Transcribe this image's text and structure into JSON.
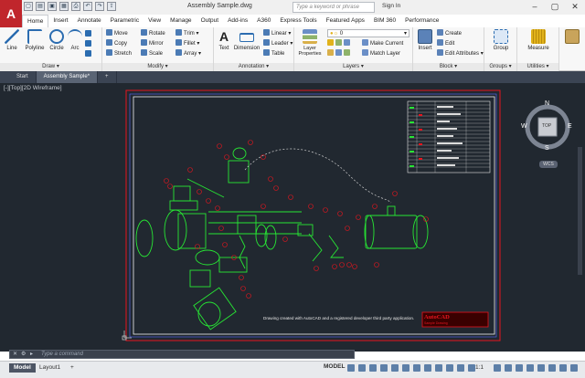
{
  "app": {
    "logo_letter": "A",
    "document_title": "Assembly Sample.dwg",
    "search_placeholder": "Type a keyword or phrase",
    "signin_label": "Sign In"
  },
  "qat_icons": [
    "new-icon",
    "open-icon",
    "save-icon",
    "saveas-icon",
    "print-icon",
    "undo-icon",
    "redo-icon",
    "share-icon"
  ],
  "tabs": [
    "Home",
    "Insert",
    "Annotate",
    "Parametric",
    "View",
    "Manage",
    "Output",
    "Add-ins",
    "A360",
    "Express Tools",
    "Featured Apps",
    "BIM 360",
    "Performance"
  ],
  "ribbon": {
    "draw": {
      "title": "Draw",
      "line": "Line",
      "polyline": "Polyline",
      "circle": "Circle",
      "arc": "Arc"
    },
    "modify": {
      "title": "Modify",
      "move": "Move",
      "copy": "Copy",
      "stretch": "Stretch",
      "rotate": "Rotate",
      "mirror": "Mirror",
      "scale": "Scale",
      "trim": "Trim",
      "fillet": "Fillet",
      "array": "Array"
    },
    "annotation": {
      "title": "Annotation",
      "text": "Text",
      "dimension": "Dimension",
      "linear": "Linear",
      "leader": "Leader",
      "table": "Table"
    },
    "layers": {
      "title": "Layers",
      "layer_properties": "Layer Properties",
      "layer_value": "0",
      "make_current": "Make Current",
      "match_layer": "Match Layer"
    },
    "block": {
      "title": "Block",
      "insert": "Insert",
      "create": "Create",
      "edit": "Edit",
      "edit_attributes": "Edit Attributes"
    },
    "groups": {
      "title": "Groups",
      "group": "Group"
    },
    "utilities": {
      "title": "Utilities",
      "measure": "Measure"
    }
  },
  "file_tabs": [
    "Start",
    "Assembly Sample*"
  ],
  "viewport_label": "[-][Top][2D Wireframe]",
  "viewcube": {
    "top": "TOP",
    "north": "N",
    "south": "S",
    "east": "E",
    "west": "W",
    "wcs": "WCS"
  },
  "drawing": {
    "note": "Drawing created with AutoCAD and a registered developer third party application.",
    "logo_text": "AutoCAD",
    "logo_sub": "Sample Drawing"
  },
  "command_placeholder": "Type a command",
  "layout_tabs": [
    "Model",
    "Layout1"
  ],
  "status": {
    "model_label": "MODEL",
    "scale": "1:1"
  },
  "colors": {
    "accent": "#c0262c",
    "canvas": "#212830",
    "geometry": "#27e634",
    "annotation": "#e8151e"
  }
}
